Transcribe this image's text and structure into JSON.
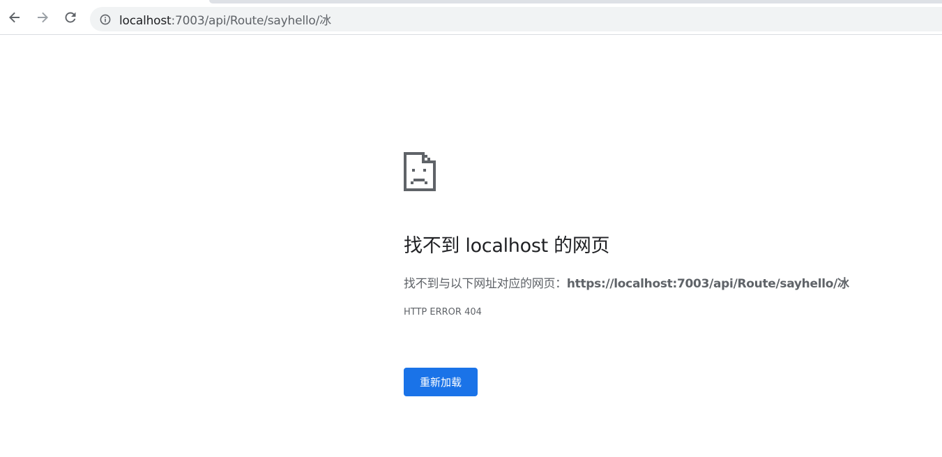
{
  "browser": {
    "url_host": "localhost",
    "url_rest": ":7003/api/Route/sayhello/冰",
    "icons": {
      "back": "back-arrow-icon",
      "forward": "forward-arrow-icon",
      "reload": "reload-icon",
      "site_info": "info-icon"
    }
  },
  "error_page": {
    "icon": "sad-document-icon",
    "title": "找不到 localhost 的网页",
    "summary_prefix": "找不到与以下网址对应的网页：",
    "summary_url": "https://localhost:7003/api/Route/sayhello/冰",
    "error_code": "HTTP ERROR 404",
    "reload_button_label": "重新加载",
    "colors": {
      "button": "#1a73e8",
      "title": "#202124",
      "secondary_text": "#5f6368"
    }
  }
}
